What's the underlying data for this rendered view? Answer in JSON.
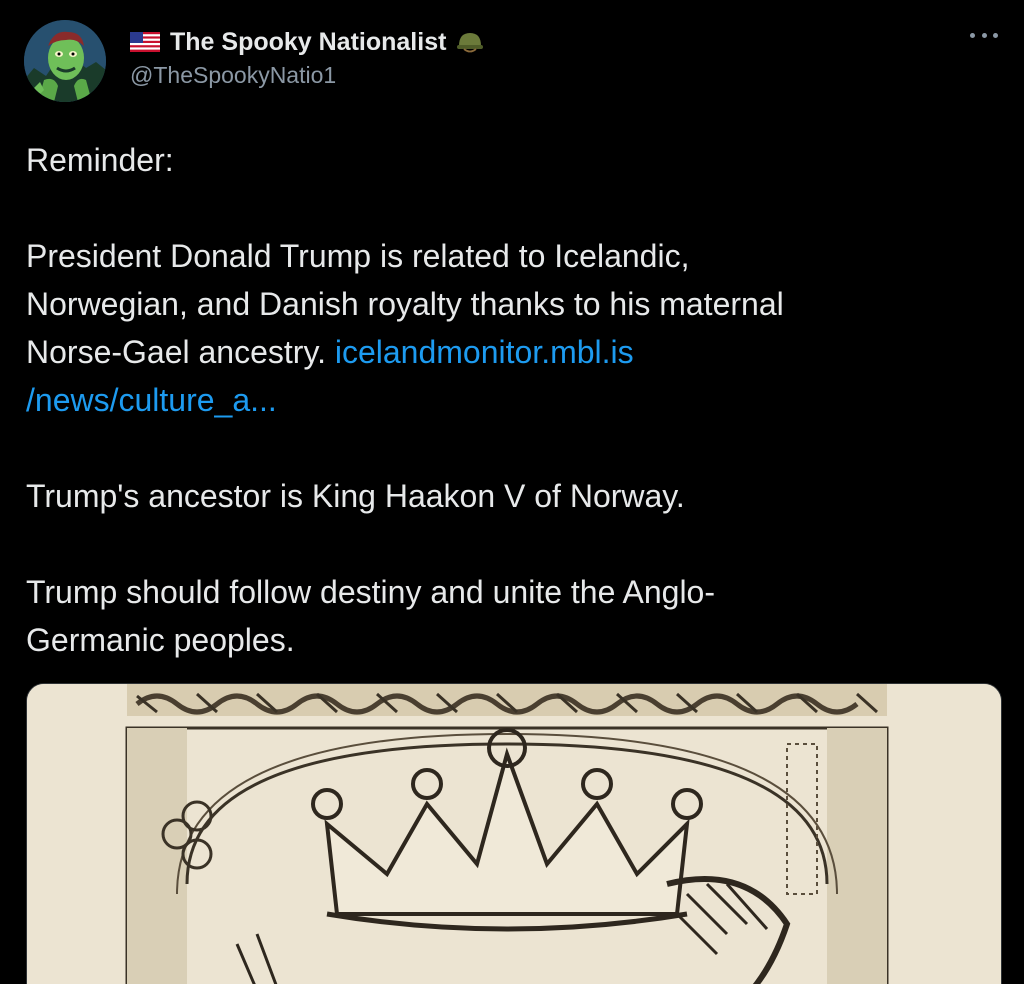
{
  "author": {
    "flag_icon": "us-flag-icon",
    "display_name": "The Spooky Nationalist",
    "badge_icon": "military-helmet-icon",
    "handle": "@TheSpookyNatio1",
    "avatar_icon": "green-ghoul-avatar"
  },
  "menu": {
    "icon": "more-options-icon"
  },
  "tweet": {
    "line1": "Reminder:",
    "para2_part1": "President Donald Trump is related to Icelandic,",
    "para2_part2": "Norwegian, and Danish royalty thanks to his maternal",
    "para2_part3": "Norse-Gael ancestry.",
    "link_part1": "icelandmonitor.mbl.is",
    "link_part2": "/news/culture_a...",
    "para3": "Trump's ancestor is King Haakon V of Norway.",
    "para4_part1": "Trump should follow destiny and unite the Anglo-",
    "para4_part2": "Germanic peoples."
  },
  "media": {
    "description_icon": "engraving-crowned-king-image"
  },
  "colors": {
    "background": "#000000",
    "text": "#e7e9ea",
    "secondary_text": "#8b98a5",
    "link": "#1d9bf0"
  }
}
